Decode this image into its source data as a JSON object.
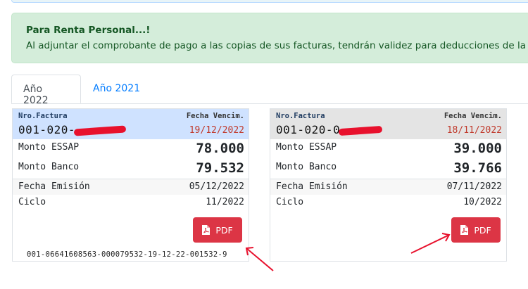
{
  "alert": {
    "title": "Para Renta Personal...!",
    "text": "Al adjuntar el comprobante de pago a las copias de sus facturas, tendrán validez para deducciones de la"
  },
  "tabs": [
    {
      "label": "Año 2022",
      "active": true
    },
    {
      "label": "Año 2021",
      "active": false
    }
  ],
  "cards": [
    {
      "nro_label": "Nro.Factura",
      "venc_label": "Fecha Vencim.",
      "nro_prefix": "001-020-",
      "venc_date": "19/12/2022",
      "monto_essap_label": "Monto ESSAP",
      "monto_essap": "78.000",
      "monto_banco_label": "Monto Banco",
      "monto_banco": "79.532",
      "emision_label": "Fecha Emisión",
      "emision": "05/12/2022",
      "ciclo_label": "Ciclo",
      "ciclo": "11/2022",
      "pdf_label": "PDF",
      "code": "001-06641608563-000079532-19-12-22-001532-9"
    },
    {
      "nro_label": "Nro.Factura",
      "venc_label": "Fecha Vencim.",
      "nro_prefix": "001-020-0",
      "venc_date": "18/11/2022",
      "monto_essap_label": "Monto ESSAP",
      "monto_essap": "39.000",
      "monto_banco_label": "Monto Banco",
      "monto_banco": "39.766",
      "emision_label": "Fecha Emisión",
      "emision": "07/11/2022",
      "ciclo_label": "Ciclo",
      "ciclo": "10/2022",
      "pdf_label": "PDF"
    }
  ],
  "colors": {
    "pdf_button": "#dc3545",
    "annotation_arrow": "#e8112d",
    "alert_bg": "#d4edda"
  }
}
